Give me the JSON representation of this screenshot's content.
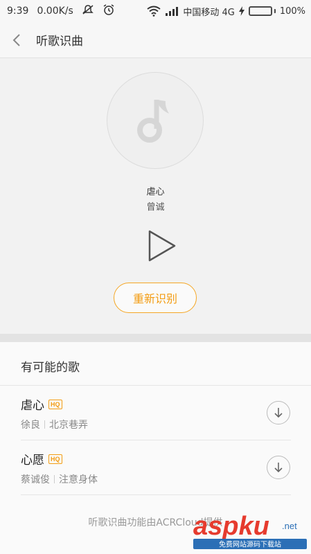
{
  "status_bar": {
    "time": "9:39",
    "net_speed": "0.00K/s",
    "carrier": "中国移动 4G",
    "battery": "100%",
    "battery_level": 1.0
  },
  "header": {
    "title": "听歌识曲",
    "back_icon": "chevron-left-icon"
  },
  "player": {
    "song_name": "虐心",
    "artist": "曾诚",
    "rerecognize_label": "重新识别",
    "disc_icon": "music-note-icon",
    "play_icon": "play-icon"
  },
  "results": {
    "section_title": "有可能的歌",
    "hq_label": "HQ",
    "songs": [
      {
        "title": "虐心",
        "artist": "徐良",
        "album": "北京巷弄"
      },
      {
        "title": "心愿",
        "artist": "蔡诚俊",
        "album": "注意身体"
      }
    ],
    "footer_note": "听歌识曲功能由ACRCloud提供"
  },
  "watermark": {
    "brand": "aspku",
    "domain": ".net",
    "tagline": "免费网站源码下载站"
  },
  "colors": {
    "accent": "#f39c12",
    "battery": "#4cd038"
  }
}
